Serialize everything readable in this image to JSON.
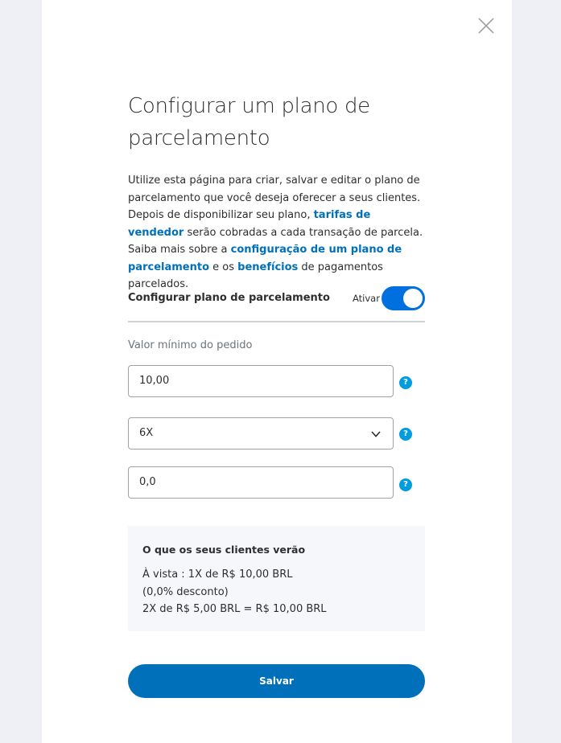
{
  "modal": {
    "title": "Configurar um plano de parcelamento",
    "description": {
      "part1": "Utilize esta página para criar, salvar e editar o plano de parcelamento que você deseja oferecer a seus clientes. Depois de disponibilizar seu plano, ",
      "link_fees": "tarifas de vendedor",
      "part2": " serão cobradas a cada transação de parcela. Saiba mais sobre a ",
      "link_config": "configuração de um plano de parcelamento",
      "part3": " e os ",
      "link_benefits": "benefícios",
      "part4": " de pagamentos parcelados."
    }
  },
  "toggle": {
    "label": "Configurar plano de parcelamento",
    "state_label": "Ativar",
    "on": true
  },
  "form": {
    "min_order_label": "Valor mínimo do pedido",
    "min_order_value": "10,00",
    "installments_value": "6X",
    "discount_value": "0,0",
    "help_glyph": "?"
  },
  "preview": {
    "title": "O que os seus clientes verão",
    "line1": "À vista : 1X de R$ 10,00 BRL",
    "line2": "(0,0% desconto)",
    "line3": "2X de R$ 5,00 BRL = R$ 10,00 BRL"
  },
  "actions": {
    "save_label": "Salvar"
  },
  "icons": {
    "close": "close-icon",
    "chevron": "chevron-down-icon",
    "help": "help-icon"
  },
  "colors": {
    "accent": "#0070ba",
    "toggle": "#0070e0",
    "help": "#009cde"
  }
}
